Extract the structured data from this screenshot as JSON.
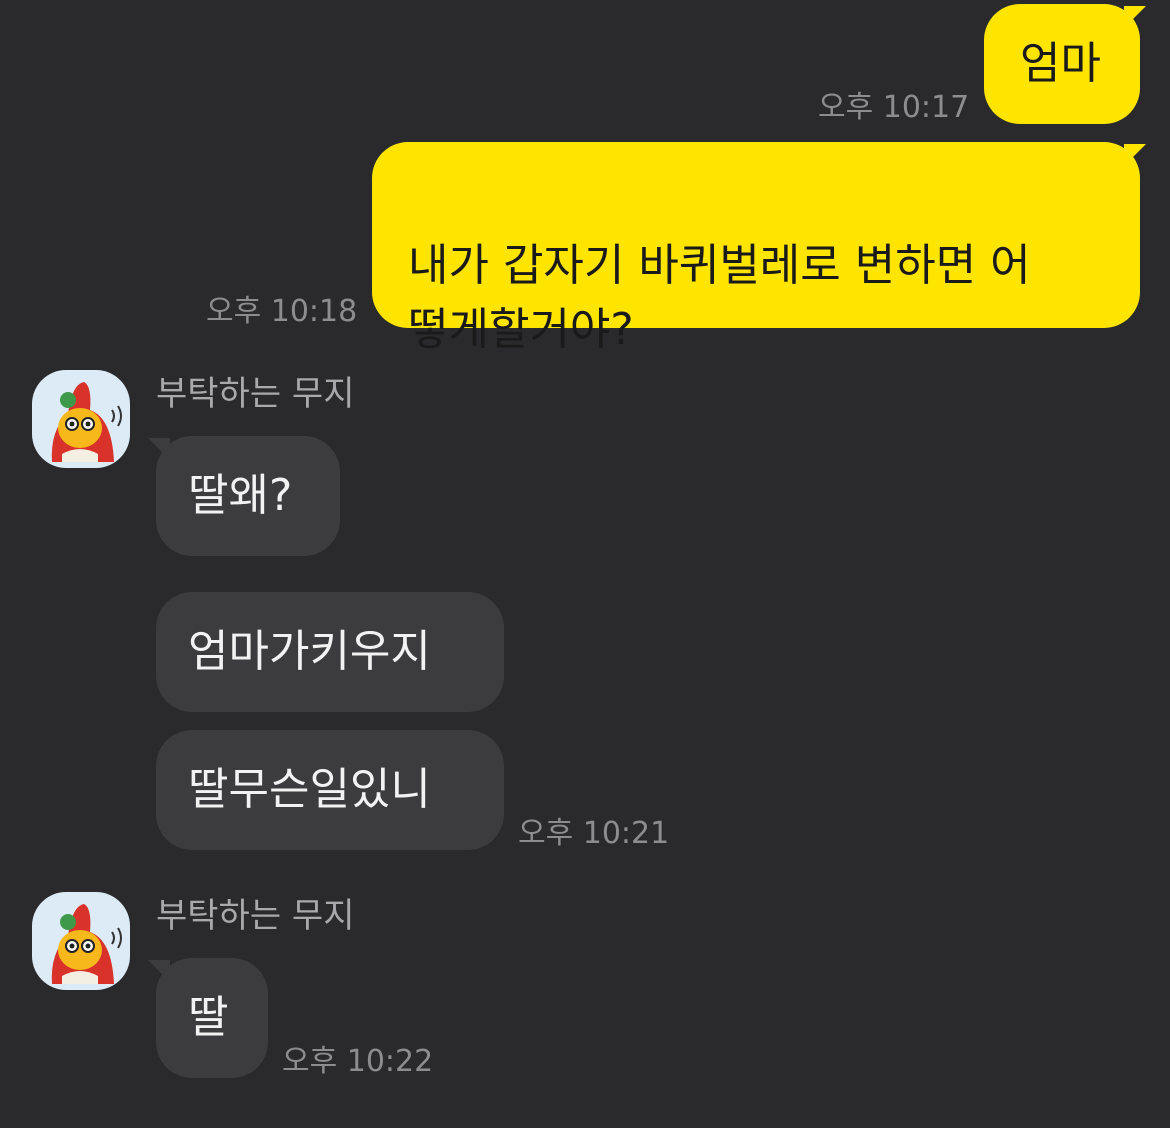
{
  "messages": [
    {
      "from": "me",
      "text": "엄마",
      "time": "오후 10:17"
    },
    {
      "from": "me",
      "text": "내가 갑자기 바퀴벌레로 변하면 어\n떻게할거야?",
      "time": "오후 10:18"
    },
    {
      "from": "other",
      "sender": "부탁하는 무지",
      "text": "딸왜?"
    },
    {
      "from": "other",
      "text": "엄마가키우지"
    },
    {
      "from": "other",
      "text": "딸무슨일있니",
      "time": "오후 10:21"
    },
    {
      "from": "other",
      "sender": "부탁하는 무지",
      "text": "딸",
      "time": "오후 10:22"
    }
  ],
  "avatar_icon": "muzi-character-avatar",
  "colors": {
    "background": "#2a2a2c",
    "my_bubble": "#fde500",
    "other_bubble": "#3c3c3f",
    "time_text": "#8d8d90"
  }
}
